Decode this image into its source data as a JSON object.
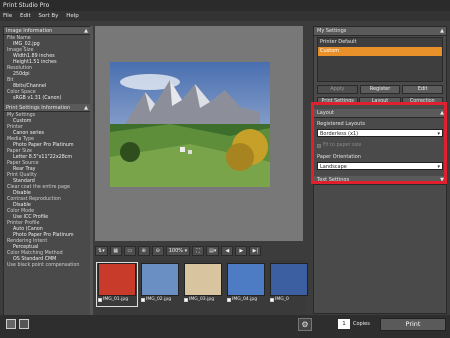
{
  "window": {
    "title": "Print Studio Pro"
  },
  "menu": [
    "File",
    "Edit",
    "Sort By",
    "Help"
  ],
  "image_info": {
    "header": "Image Information",
    "rows": [
      {
        "k": "File Name",
        "v": "IMG_02.jpg"
      },
      {
        "k": "Image Size",
        "v": "Width1.89 inches"
      },
      {
        "k": "",
        "v": "Height1.51 inches"
      },
      {
        "k": "Resolution",
        "v": "250dpi"
      },
      {
        "k": "Bit",
        "v": "8bits/Channel"
      },
      {
        "k": "Color Space",
        "v": "sRGB v1.31 (Canon)"
      }
    ]
  },
  "print_info": {
    "header": "Print Settings Information",
    "rows": [
      {
        "k": "My Settings",
        "v": "Custom"
      },
      {
        "k": "Printer",
        "v": "Canon series"
      },
      {
        "k": "Media Type",
        "v": "Photo Paper Pro Platinum"
      },
      {
        "k": "Paper Size",
        "v": "Letter 8.5\"x11\"22x28cm"
      },
      {
        "k": "Paper Source",
        "v": "Rear Tray"
      },
      {
        "k": "Print Quality",
        "v": "Standard"
      },
      {
        "k": "Clear coat the entire page",
        "v": "Disable"
      },
      {
        "k": "Contrast Reproduction",
        "v": "Disable"
      },
      {
        "k": "Color Mode",
        "v": "Use ICC Profile"
      },
      {
        "k": "Printer Profile",
        "v": "Auto (Canon"
      },
      {
        "k": "",
        "v": "Photo Paper Pro Platinum"
      },
      {
        "k": "Rendering Intent",
        "v": "Perceptual"
      },
      {
        "k": "Color Matching Method",
        "v": "OS Standard CMM"
      },
      {
        "k": "Use black point compensation",
        "v": ""
      }
    ]
  },
  "toolbar": {
    "zoom": "100%"
  },
  "thumbnails": [
    {
      "name": "IMG_01.jpg",
      "color": "#c83a2a",
      "selected": true
    },
    {
      "name": "IMG_02.jpg",
      "color": "#6a8fc2",
      "selected": false
    },
    {
      "name": "IMG_03.jpg",
      "color": "#d8c5a0",
      "selected": false
    },
    {
      "name": "IMG_04.jpg",
      "color": "#4d7cc4",
      "selected": false
    },
    {
      "name": "IMG_0",
      "color": "#3b5fa0",
      "selected": false
    }
  ],
  "my_settings": {
    "header": "My Settings",
    "items": [
      "Printer Default",
      "Custom"
    ],
    "selected_index": 1,
    "apply": "Apply",
    "register": "Register",
    "edit": "Edit"
  },
  "tabs": [
    "Print Settings",
    "Layout",
    "Correction"
  ],
  "layout_panel": {
    "header": "Layout",
    "registered_layouts_label": "Registered Layouts",
    "registered_layout_value": "Borderless (x1)",
    "fit_label": "Fit to paper size",
    "orientation_label": "Paper Orientation",
    "orientation_value": "Landscape",
    "text_settings": "Text Settings"
  },
  "print": {
    "copies_label": "Copies",
    "copies_value": "1",
    "button": "Print"
  },
  "colors": {
    "accent": "#e8912a",
    "highlight_box": "#e0202c"
  }
}
